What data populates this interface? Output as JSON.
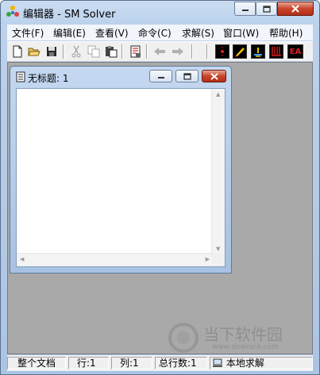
{
  "window": {
    "title": "编辑器 - SM Solver"
  },
  "menu": [
    "文件(F)",
    "编辑(E)",
    "查看(V)",
    "命令(C)",
    "求解(S)",
    "窗口(W)",
    "帮助(H)"
  ],
  "toolbar": {
    "buttons": [
      "new-file-icon",
      "open-folder-icon",
      "save-icon",
      "cut-icon",
      "copy-icon",
      "paste-icon",
      "document-icon",
      "back-arrow-icon",
      "forward-arrow-icon",
      "stop-icon",
      "pencil-icon",
      "signal-icon",
      "down-arrows-icon"
    ],
    "ea_label": "EA"
  },
  "child_window": {
    "title": "无标题: 1"
  },
  "status": {
    "scope": "整个文档",
    "line": "行:1",
    "column": "列:1",
    "total_lines": "总行数:1",
    "mode": "本地求解"
  },
  "watermark": {
    "text": "当下软件园",
    "url": "www.downxia.com"
  },
  "colors": {
    "workspace": "#a9a9a9",
    "close_button": "#c8442a",
    "toolbar_red": "#e02020"
  }
}
